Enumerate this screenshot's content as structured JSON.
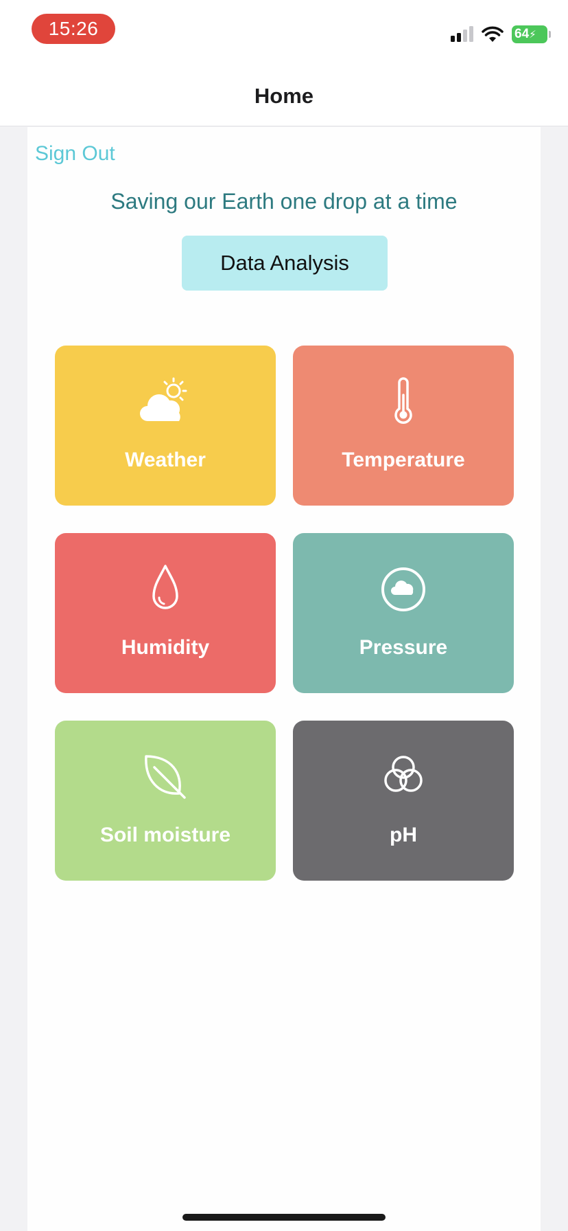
{
  "status_bar": {
    "time": "15:26",
    "battery_level": "64",
    "icons": [
      "cellular-signal-icon",
      "wifi-icon",
      "battery-charging-icon"
    ]
  },
  "nav": {
    "title": "Home"
  },
  "main": {
    "sign_out_label": "Sign Out",
    "tagline": "Saving our Earth one drop at a time",
    "data_analysis_label": "Data Analysis",
    "tiles": [
      {
        "label": "Weather",
        "icon": "partly-sunny-icon",
        "color": "#f7cc4c"
      },
      {
        "label": "Temperature",
        "icon": "thermometer-icon",
        "color": "#ee8a72"
      },
      {
        "label": "Humidity",
        "icon": "water-drop-icon",
        "color": "#ec6b68"
      },
      {
        "label": "Pressure",
        "icon": "cloud-circle-icon",
        "color": "#7db9ae"
      },
      {
        "label": "Soil moisture",
        "icon": "leaf-icon",
        "color": "#b3db8b"
      },
      {
        "label": "pH",
        "icon": "three-circles-icon",
        "color": "#6c6b6e"
      }
    ]
  },
  "colors": {
    "accent": "#5cc8d6",
    "tagline": "#2d7a80",
    "button_bg": "#b8ecf0",
    "time_pill": "#e0453b",
    "battery": "#4cc75a"
  }
}
